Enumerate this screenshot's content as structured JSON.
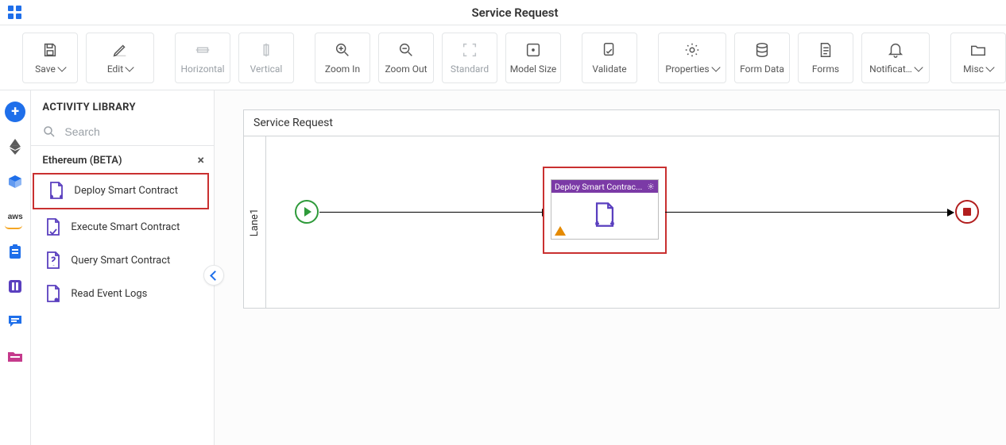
{
  "header": {
    "title": "Service Request"
  },
  "toolbar": [
    {
      "id": "save",
      "label": "Save",
      "dropdown": true
    },
    {
      "id": "edit",
      "label": "Edit",
      "dropdown": true
    },
    {
      "id": "horiz",
      "label": "Horizontal",
      "disabled": true
    },
    {
      "id": "vert",
      "label": "Vertical",
      "disabled": true
    },
    {
      "id": "zoomin",
      "label": "Zoom In"
    },
    {
      "id": "zoomout",
      "label": "Zoom Out"
    },
    {
      "id": "standard",
      "label": "Standard",
      "disabled": true
    },
    {
      "id": "modelsize",
      "label": "Model Size"
    },
    {
      "id": "validate",
      "label": "Validate"
    },
    {
      "id": "properties",
      "label": "Properties",
      "dropdown": true
    },
    {
      "id": "formdata",
      "label": "Form Data"
    },
    {
      "id": "forms",
      "label": "Forms"
    },
    {
      "id": "notif",
      "label": "Notificat…",
      "dropdown": true
    },
    {
      "id": "misc",
      "label": "Misc",
      "dropdown": true
    }
  ],
  "rail": {
    "items": [
      "add",
      "ethereum",
      "box",
      "aws",
      "clipboard",
      "pause",
      "chat",
      "folder"
    ]
  },
  "sidebar": {
    "title": "ACTIVITY LIBRARY",
    "search_placeholder": "Search",
    "category": "Ethereum (BETA)",
    "activities": [
      "Deploy Smart Contract",
      "Execute Smart Contract",
      "Query Smart Contract",
      "Read Event Logs"
    ],
    "selected_index": 0
  },
  "canvas": {
    "title": "Service Request",
    "lane": "Lane1",
    "node": {
      "title": "Deploy Smart Contrac...",
      "has_warning": true
    }
  },
  "icons": {
    "apps": "apps-icon",
    "save": "floppy-icon",
    "edit": "pencil-icon",
    "horizontal": "align-horizontal-icon",
    "vertical": "align-vertical-icon",
    "zoom_in": "zoom-in-icon",
    "zoom_out": "zoom-out-icon",
    "standard": "fit-standard-icon",
    "model_size": "fit-model-icon",
    "validate": "validate-icon",
    "properties": "gear-icon",
    "form_data": "database-icon",
    "forms": "document-icon",
    "notifications": "bell-icon",
    "misc": "folder-icon",
    "search": "search-icon",
    "close": "close-icon",
    "doc_deploy": "doc-arrows-icon",
    "doc_execute": "doc-check-icon",
    "doc_query": "doc-question-icon",
    "doc_log": "doc-dot-icon"
  },
  "colors": {
    "accent_blue": "#1f6fea",
    "highlight_red": "#c93030",
    "start_green": "#2e9a3a",
    "end_red": "#b21e1e",
    "node_purple": "#7b3aa6",
    "warning_orange": "#e58a00"
  }
}
